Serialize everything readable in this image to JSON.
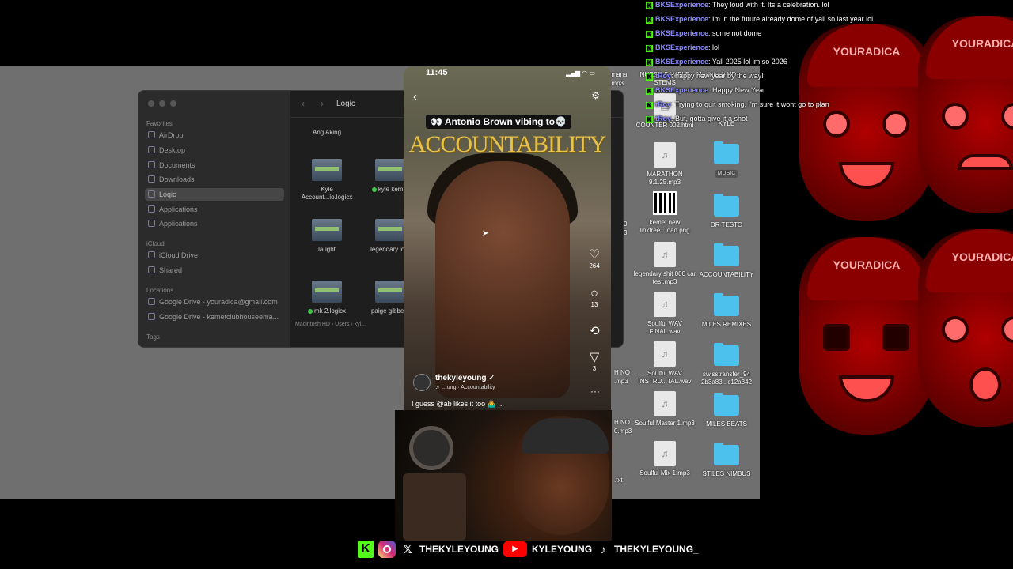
{
  "finder": {
    "title": "Logic",
    "sidebar": {
      "favorites_header": "Favorites",
      "items": [
        "AirDrop",
        "Desktop",
        "Documents",
        "Downloads",
        "Logic",
        "Applications",
        "Applications"
      ],
      "icloud_header": "iCloud",
      "icloud_items": [
        "iCloud Drive",
        "Shared"
      ],
      "locations_header": "Locations",
      "locations": [
        "Google Drive - youradica@gmail.com",
        "Google Drive - kemetclubhouseema..."
      ],
      "tags_header": "Tags"
    },
    "files": [
      {
        "name": "Ang Aking",
        "top": "r0"
      },
      {
        "name": "Kyle Account...io.logicx"
      },
      {
        "name": "kyle kem..."
      },
      {
        "name": "laught"
      },
      {
        "name": "legendary.lo..."
      },
      {
        "name": "mk 2.logicx"
      },
      {
        "name": "paige gibbe..."
      }
    ],
    "pathbar": "Macintosh HD  ›  Users  ›  kyl..."
  },
  "desktop_icons": [
    {
      "label": "NURSE SAMPLE STEMS",
      "kind": "label"
    },
    {
      "label": "COUNTER 002.html",
      "kind": "doc"
    },
    {
      "label": "KYLE",
      "kind": "doc"
    },
    {
      "label": "MARATHON 9.1.25.mp3",
      "kind": "doc"
    },
    {
      "label": "MUSIC",
      "kind": "folder"
    },
    {
      "label": "kemet new linktree...load.png",
      "kind": "qr"
    },
    {
      "label": "DR TESTO",
      "kind": "folder"
    },
    {
      "label": "legendary shit 000 car test.mp3",
      "kind": "doc"
    },
    {
      "label": "ACCOUNTABILITY",
      "kind": "folder"
    },
    {
      "label": "Soulful WAV FINAL.wav",
      "kind": "doc"
    },
    {
      "label": "MILES REMIXES",
      "kind": "folder"
    },
    {
      "label": "Soulful WAV INSTRU...TAL.wav",
      "kind": "doc"
    },
    {
      "label": "swisstransfer_94 2b3a83...c12a342",
      "kind": "folder"
    },
    {
      "label": "Soulful Master 1.mp3",
      "kind": "doc"
    },
    {
      "label": "MILES BEATS",
      "kind": "folder"
    },
    {
      "label": "Soulful Mix 1.mp3",
      "kind": "doc"
    },
    {
      "label": "STILES NIMBUS",
      "kind": "folder"
    }
  ],
  "desktop_partial": {
    "a": "gmana",
    "b": "r.mp3",
    "c": "Macintosh HD",
    "d": "H NO",
    "e": ".mp3",
    "f": "H NO",
    "g": "0.mp3",
    "h": ".txt",
    "i": "0",
    "j": "3"
  },
  "chat": [
    {
      "user": "BKSExperience",
      "text": "They loud with it. Its a celebration. lol"
    },
    {
      "user": "BKSExperience",
      "text": "Im in the future already dome of yall so last year lol"
    },
    {
      "user": "BKSExperience",
      "text": "some not dome"
    },
    {
      "user": "BKSExperience",
      "text": "lol"
    },
    {
      "user": "BKSExperience",
      "text": "Yall 2025 lol im so 2026"
    },
    {
      "user": "tRoy",
      "text": "happy new year by the way!"
    },
    {
      "user": "BKSExperience",
      "text": "Happy New Year"
    },
    {
      "user": "tRoy",
      "text": "Trying to quit smoking, I'm sure it wont go to plan"
    },
    {
      "user": "tRoy",
      "text": "But, gotta give it a shot"
    }
  ],
  "phone": {
    "time": "11:45",
    "status": "▂▄▆ ◠ ▭",
    "caption": "👀 Antonio Brown vibing to💀",
    "banner": "ACCOUNTABILITY",
    "likes": "264",
    "comments": "13",
    "shares": "",
    "sends": "3",
    "account": "thekyleyoung",
    "sound": "♬ ...ung · Accountability",
    "description": "I guess @ab likes it too 🤷‍♂️ ..."
  },
  "socials": {
    "x_handle": "THEKYLEYOUNG",
    "youtube_handle": "KYLEYOUNG",
    "tiktok_handle": "THEKYLEYOUNG_"
  },
  "faces": {
    "brand": "YOURADICA"
  },
  "colors": {
    "kick_green": "#53fc18",
    "folder_blue": "#4dc1ee",
    "face_red": "#b00000"
  }
}
